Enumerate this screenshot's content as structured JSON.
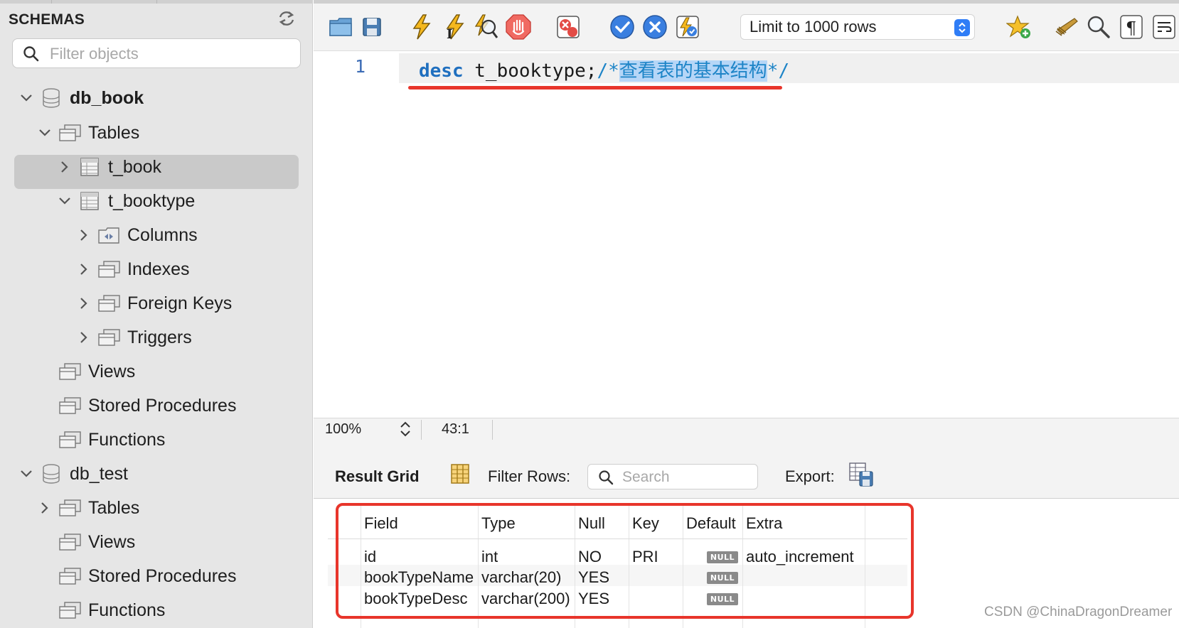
{
  "sidebar": {
    "title": "SCHEMAS",
    "filter_placeholder": "Filter objects",
    "tree": {
      "db1": "db_book",
      "db1_tables": "Tables",
      "t_book": "t_book",
      "t_booktype": "t_booktype",
      "columns": "Columns",
      "indexes": "Indexes",
      "foreign_keys": "Foreign Keys",
      "triggers": "Triggers",
      "db1_views": "Views",
      "db1_procs": "Stored Procedures",
      "db1_funcs": "Functions",
      "db2": "db_test",
      "db2_tables": "Tables",
      "db2_views": "Views",
      "db2_procs": "Stored Procedures",
      "db2_funcs": "Functions"
    }
  },
  "toolbar": {
    "limit_label": "Limit to 1000 rows"
  },
  "editor": {
    "line_number": "1",
    "keyword": "desc",
    "identifier": " t_booktype;",
    "comment_open": "/*",
    "comment_text": "查看表的基本结构",
    "comment_close": "*/"
  },
  "status": {
    "zoom": "100%",
    "cursor": "43:1"
  },
  "result_bar": {
    "grid_label": "Result Grid",
    "filter_label": "Filter Rows:",
    "search_placeholder": "Search",
    "export_label": "Export:"
  },
  "grid": {
    "columns": [
      "Field",
      "Type",
      "Null",
      "Key",
      "Default",
      "Extra"
    ],
    "null_label": "NULL",
    "rows": [
      {
        "field": "id",
        "type": "int",
        "null": "NO",
        "key": "PRI",
        "extra": "auto_increment"
      },
      {
        "field": "bookTypeName",
        "type": "varchar(20)",
        "null": "YES",
        "key": "",
        "extra": ""
      },
      {
        "field": "bookTypeDesc",
        "type": "varchar(200)",
        "null": "YES",
        "key": "",
        "extra": ""
      }
    ]
  },
  "watermark": "CSDN @ChinaDragonDreamer",
  "colors": {
    "accent_blue": "#2f7df6",
    "annotation_red": "#e8352b",
    "sidebar_bg": "#e6e6e6",
    "selection_bg": "#c9c9c9"
  }
}
